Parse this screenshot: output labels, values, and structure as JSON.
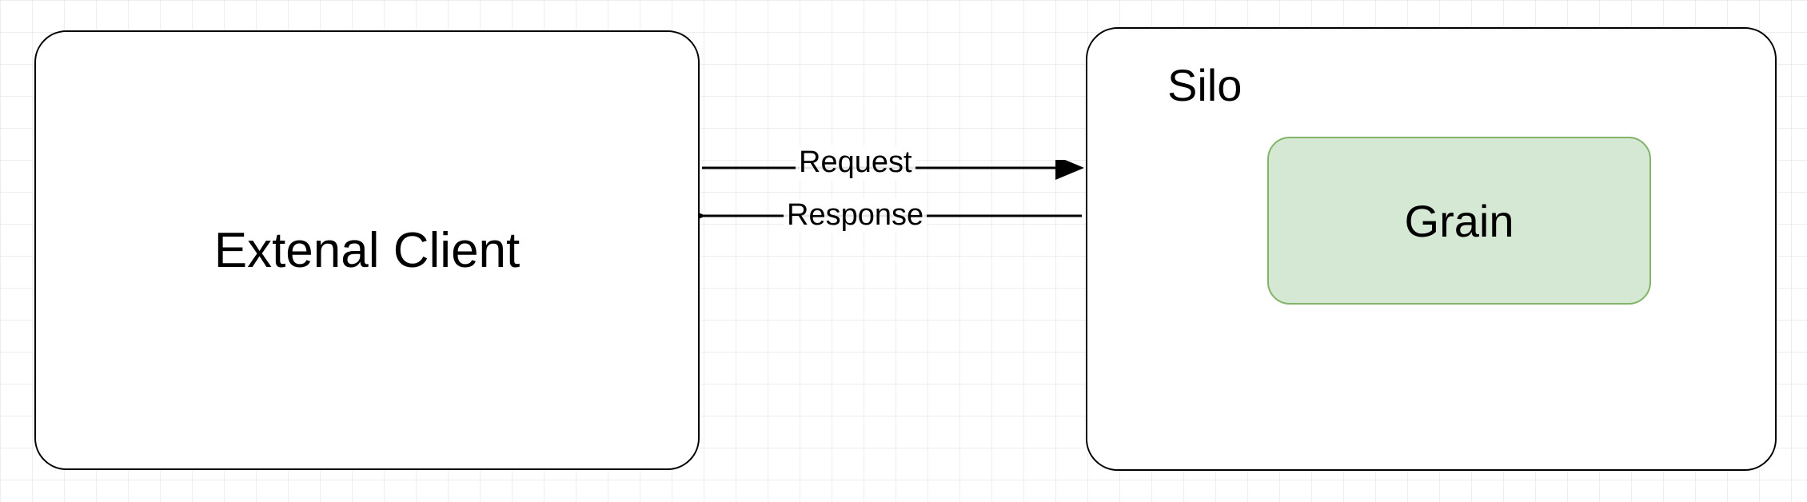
{
  "client": {
    "label": "Extenal Client"
  },
  "silo": {
    "title": "Silo",
    "grain_label": "Grain"
  },
  "arrows": {
    "request_label": "Request",
    "response_label": "Response"
  }
}
